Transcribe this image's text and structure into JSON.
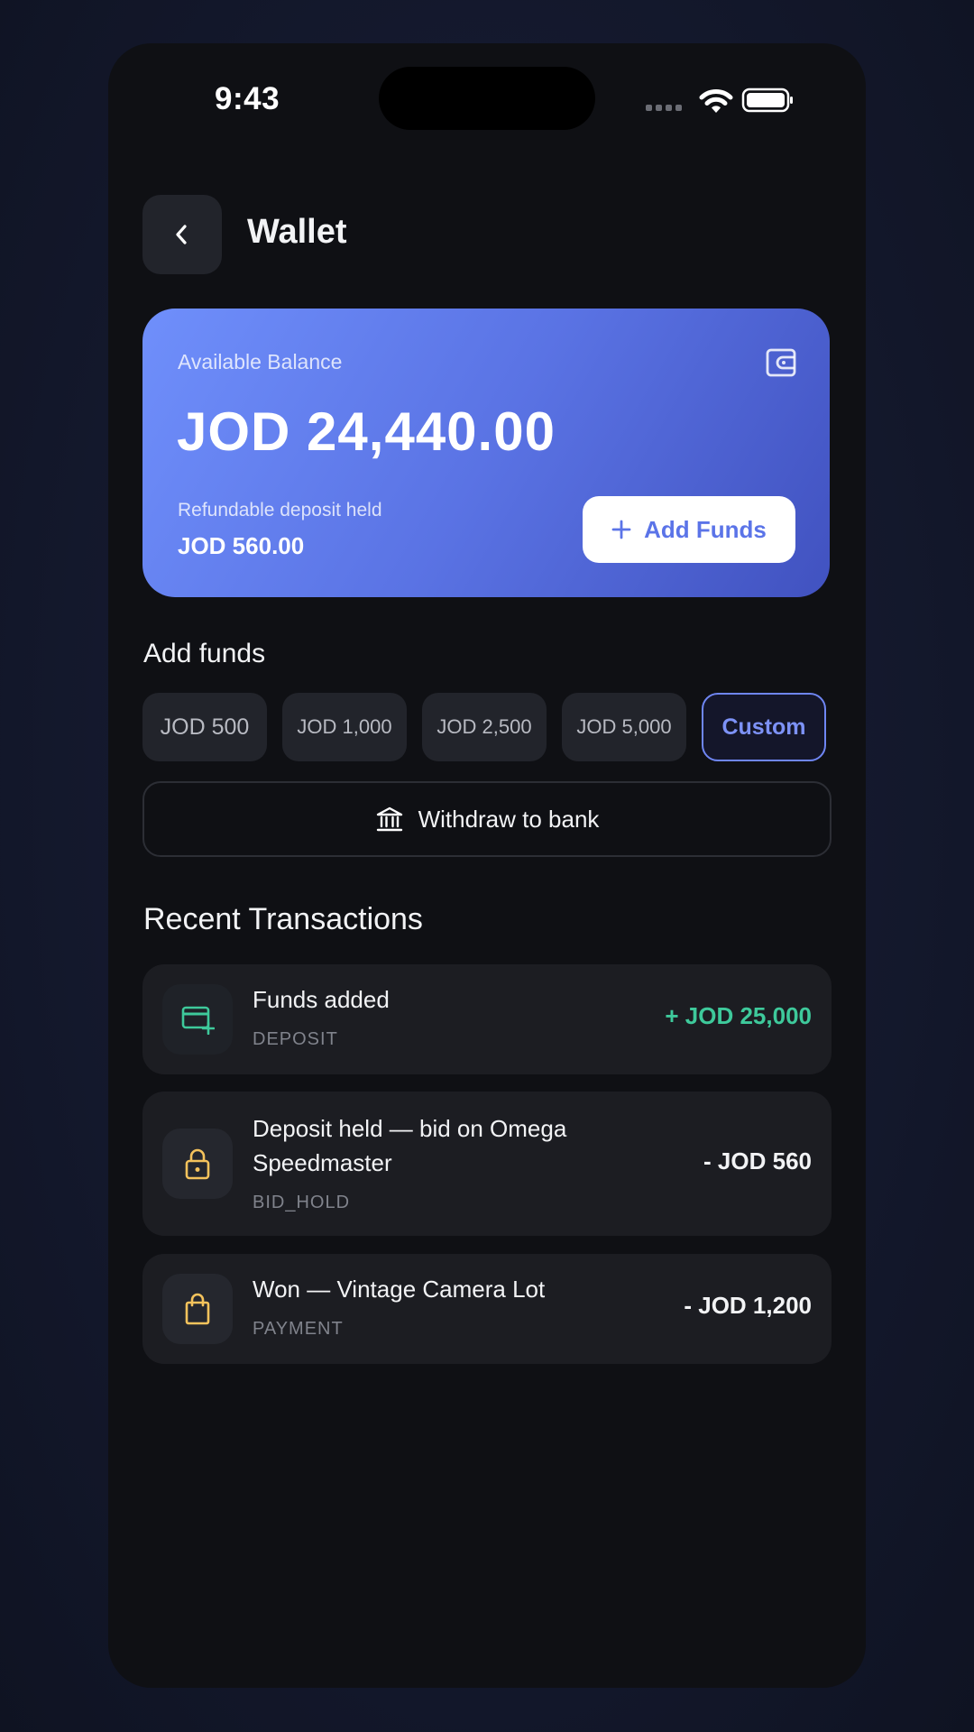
{
  "status_bar": {
    "time": "9:43"
  },
  "header": {
    "title": "Wallet",
    "back_icon": "chevron-left-icon"
  },
  "balance_card": {
    "label": "Available Balance",
    "amount": "JOD 24,440.00",
    "deposit_label": "Refundable deposit held",
    "deposit_amount": "JOD 560.00",
    "add_funds_label": "Add Funds",
    "icon": "wallet-icon"
  },
  "add_funds": {
    "title": "Add funds",
    "options": [
      "JOD 500",
      "JOD 1,000",
      "JOD 2,500",
      "JOD 5,000",
      "Custom"
    ]
  },
  "withdraw": {
    "label": "Withdraw to bank",
    "icon": "bank-icon"
  },
  "recent": {
    "title": "Recent Transactions",
    "items": [
      {
        "title": "Funds added",
        "type": "DEPOSIT",
        "amount": "+ JOD 25,000",
        "icon": "card-add-icon",
        "color": "#3ec99b"
      },
      {
        "title": "Deposit held — bid on Omega Speedmaster",
        "type": "BID_HOLD",
        "amount": "- JOD 560",
        "icon": "lock-icon",
        "color": "#f5c35c"
      },
      {
        "title": "Won — Vintage Camera Lot",
        "type": "PAYMENT",
        "amount": "- JOD 1,200",
        "icon": "shopping-bag-icon",
        "color": "#f5c35c"
      }
    ]
  },
  "colors": {
    "accent": "#5b74e8",
    "positive": "#3ec99b",
    "warning": "#f5c35c",
    "background": "#0f1014"
  }
}
